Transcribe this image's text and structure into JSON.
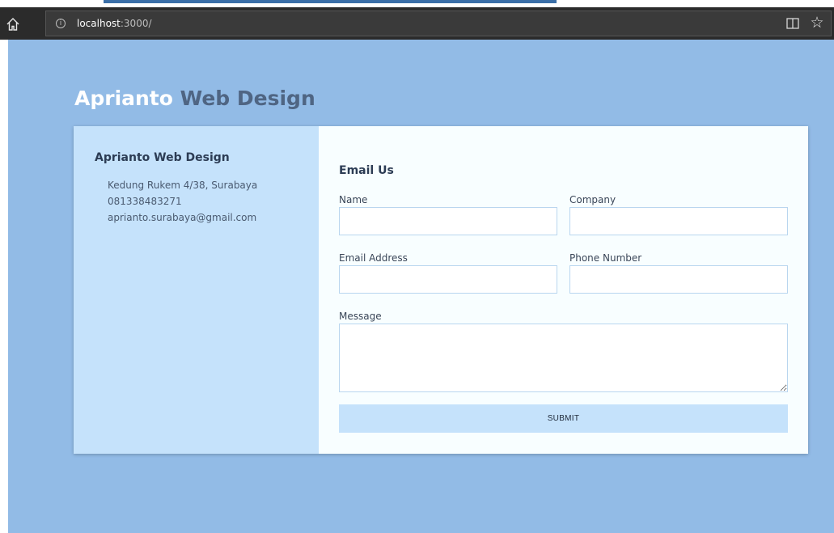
{
  "browser": {
    "url_host": "localhost",
    "url_path": ":3000/"
  },
  "site": {
    "brand_first": "Aprianto",
    "brand_rest": "Web Design"
  },
  "contact": {
    "title": "Aprianto Web Design",
    "address": "Kedung Rukem 4/38, Surabaya",
    "phone": "081338483271",
    "email": "aprianto.surabaya@gmail.com"
  },
  "form": {
    "title": "Email Us",
    "name_label": "Name",
    "company_label": "Company",
    "email_label": "Email Address",
    "phone_label": "Phone Number",
    "message_label": "Message",
    "name_value": "",
    "company_value": "",
    "email_value": "",
    "phone_value": "",
    "message_value": "",
    "submit_label": "SUBMIT"
  },
  "colors": {
    "page_bg": "#92bbe6",
    "sidebar_bg": "#c5e2fb",
    "form_bg": "#f8feff",
    "brand_dark": "#4f6583"
  }
}
